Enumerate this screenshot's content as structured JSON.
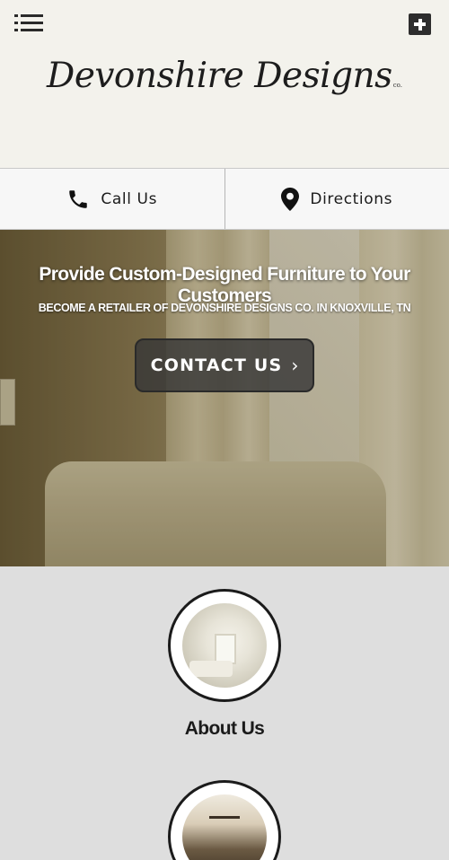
{
  "header": {
    "menu_icon": "hamburger-menu-icon",
    "add_icon": "plus-icon",
    "logo_text": "Devonshire Designs",
    "logo_suffix": "co."
  },
  "actions": [
    {
      "label": "Call Us",
      "icon": "phone-icon"
    },
    {
      "label": "Directions",
      "icon": "map-pin-icon"
    }
  ],
  "hero": {
    "title": "Provide Custom-Designed Furniture to Your Customers",
    "subtitle": "BECOME A RETAILER OF DEVONSHIRE DESIGNS CO. IN KNOXVILLE, TN",
    "cta_label": "CONTACT US",
    "cta_icon": "chevron-right-icon"
  },
  "sections": [
    {
      "label": "About Us"
    }
  ],
  "colors": {
    "header_bg": "#f3f2ec",
    "action_bar_bg": "#f7f7f7",
    "section_bg": "#dedede",
    "cta_bg": "#373737"
  }
}
